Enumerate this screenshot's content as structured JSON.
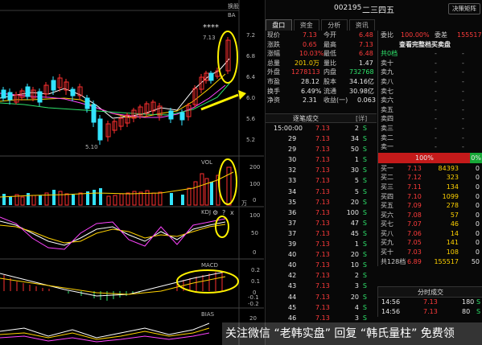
{
  "chart": {
    "top_label": "换股",
    "corner_a": "BA",
    "high_label": "7.13",
    "low_label": "5.10",
    "stars": "****",
    "price_axis": [
      "7.2",
      "6.8",
      "6.4",
      "6.0",
      "5.6",
      "5.2"
    ],
    "vol_label": "VOL",
    "vol_axis": [
      "200",
      "100",
      "0"
    ],
    "vol_unit": "万",
    "kdj_label": "KDJ",
    "kdj_axis": [
      "100",
      "50",
      "0"
    ],
    "macd_label": "MACD",
    "macd_axis": [
      "0.2",
      "0.1",
      "0",
      "-0.1",
      "-0.2"
    ],
    "bias_label": "BIAS",
    "bias_axis": [
      "20"
    ],
    "gear_icon": "gear-icon",
    "help_mark": "?",
    "close_mark": "x",
    "colors": {
      "up": "#ff3030",
      "down": "#2ee3ff",
      "ma5": "#ffffff",
      "ma10": "#ffd200",
      "ma20": "#ff44ff",
      "ma60": "#2ee36b",
      "annotation": "#fff200"
    }
  },
  "header": {
    "code": "002195",
    "name": "二三四五",
    "menu_button": "决策矩阵"
  },
  "tabs": [
    "盘口",
    "资金",
    "分析",
    "资讯"
  ],
  "quote": {
    "rows": [
      {
        "l1": "现价",
        "v1": "7.13",
        "l2": "今开",
        "v2": "6.48"
      },
      {
        "l1": "涨跌",
        "v1": "0.65",
        "l2": "最高",
        "v2": "7.13"
      },
      {
        "l1": "涨幅",
        "v1": "10.03%",
        "l2": "最低",
        "v2": "6.48"
      },
      {
        "l1": "总量",
        "v1": "201.0万",
        "l2": "量比",
        "v2": "1.47"
      },
      {
        "l1": "外盘",
        "v1": "1278113",
        "l2": "内盘",
        "v2": "732768"
      },
      {
        "l1": "市盈",
        "v1": "28.12",
        "l2": "股本",
        "v2": "34.16亿"
      },
      {
        "l1": "换手",
        "v1": "6.49%",
        "l2": "流通",
        "v2": "30.98亿"
      },
      {
        "l1": "净资",
        "v1": "2.31",
        "l2": "收益(一)",
        "v2": "0.063"
      }
    ]
  },
  "trades": {
    "title": "逐笔成交",
    "note": "[详]",
    "rows": [
      {
        "t": "15:00:00",
        "p": "7.13",
        "v": "2",
        "s": "S"
      },
      {
        "t": "29",
        "p": "7.13",
        "v": "34",
        "s": "S"
      },
      {
        "t": "29",
        "p": "7.13",
        "v": "50",
        "s": "S"
      },
      {
        "t": "30",
        "p": "7.13",
        "v": "1",
        "s": "S"
      },
      {
        "t": "32",
        "p": "7.13",
        "v": "30",
        "s": "S"
      },
      {
        "t": "33",
        "p": "7.13",
        "v": "5",
        "s": "S"
      },
      {
        "t": "34",
        "p": "7.13",
        "v": "5",
        "s": "S"
      },
      {
        "t": "35",
        "p": "7.13",
        "v": "20",
        "s": "S"
      },
      {
        "t": "36",
        "p": "7.13",
        "v": "100",
        "s": "S"
      },
      {
        "t": "37",
        "p": "7.13",
        "v": "47",
        "s": "S"
      },
      {
        "t": "37",
        "p": "7.13",
        "v": "45",
        "s": "S"
      },
      {
        "t": "39",
        "p": "7.13",
        "v": "1",
        "s": "S"
      },
      {
        "t": "40",
        "p": "7.13",
        "v": "20",
        "s": "S"
      },
      {
        "t": "40",
        "p": "7.13",
        "v": "10",
        "s": "S"
      },
      {
        "t": "42",
        "p": "7.13",
        "v": "2",
        "s": "S"
      },
      {
        "t": "43",
        "p": "7.13",
        "v": "3",
        "s": "S"
      },
      {
        "t": "44",
        "p": "7.13",
        "v": "20",
        "s": "S"
      },
      {
        "t": "45",
        "p": "7.13",
        "v": "4",
        "s": "S"
      },
      {
        "t": "46",
        "p": "7.13",
        "v": "3",
        "s": "S"
      }
    ]
  },
  "orderbook": {
    "rows": [
      {
        "l": "委比",
        "v": "100.00%",
        "l2": "委差",
        "v2": "155517"
      },
      {
        "l": "查看完整档买卖盘",
        "v": "",
        "l2": "",
        "v2": ""
      },
      {
        "l": "共0档",
        "v": "-",
        "l2": "",
        "v2": "-"
      },
      {
        "l": "卖十",
        "v": "-",
        "l2": "",
        "v2": "-"
      },
      {
        "l": "卖九",
        "v": "-",
        "l2": "",
        "v2": "-"
      },
      {
        "l": "卖八",
        "v": "-",
        "l2": "",
        "v2": "-"
      },
      {
        "l": "卖七",
        "v": "-",
        "l2": "",
        "v2": "-"
      },
      {
        "l": "卖六",
        "v": "-",
        "l2": "",
        "v2": "-"
      },
      {
        "l": "卖五",
        "v": "-",
        "l2": "",
        "v2": "-"
      },
      {
        "l": "卖四",
        "v": "-",
        "l2": "",
        "v2": "-"
      },
      {
        "l": "卖三",
        "v": "-",
        "l2": "",
        "v2": "-"
      },
      {
        "l": "卖二",
        "v": "-",
        "l2": "",
        "v2": "-"
      },
      {
        "l": "卖一",
        "v": "-",
        "l2": "",
        "v2": "-"
      }
    ],
    "bar": {
      "buy_ratio": "100%",
      "sell_ratio": "0%"
    },
    "bids": [
      {
        "l": "买一",
        "p": "7.13",
        "v": "84393",
        "c": "0"
      },
      {
        "l": "买二",
        "p": "7.12",
        "v": "323",
        "c": "0"
      },
      {
        "l": "买三",
        "p": "7.11",
        "v": "134",
        "c": "0"
      },
      {
        "l": "买四",
        "p": "7.10",
        "v": "1099",
        "c": "0"
      },
      {
        "l": "买五",
        "p": "7.09",
        "v": "278",
        "c": "0"
      },
      {
        "l": "买六",
        "p": "7.08",
        "v": "57",
        "c": "0"
      },
      {
        "l": "买七",
        "p": "7.07",
        "v": "46",
        "c": "0"
      },
      {
        "l": "买八",
        "p": "7.06",
        "v": "14",
        "c": "0"
      },
      {
        "l": "买九",
        "p": "7.05",
        "v": "141",
        "c": "0"
      },
      {
        "l": "买十",
        "p": "7.03",
        "v": "108",
        "c": "0"
      },
      {
        "l": "共128档",
        "p": "6.89",
        "v": "155517",
        "c": "50"
      }
    ]
  },
  "minute": {
    "title": "分时成交",
    "rows": [
      {
        "t": "14:56",
        "p": "7.13",
        "v": "180",
        "s": "S"
      },
      {
        "t": "14:56",
        "p": "7.13",
        "v": "80",
        "s": "S"
      }
    ]
  },
  "watermark": "关注微信 “老韩实盘” 回复 “韩氏量柱” 免费领"
}
